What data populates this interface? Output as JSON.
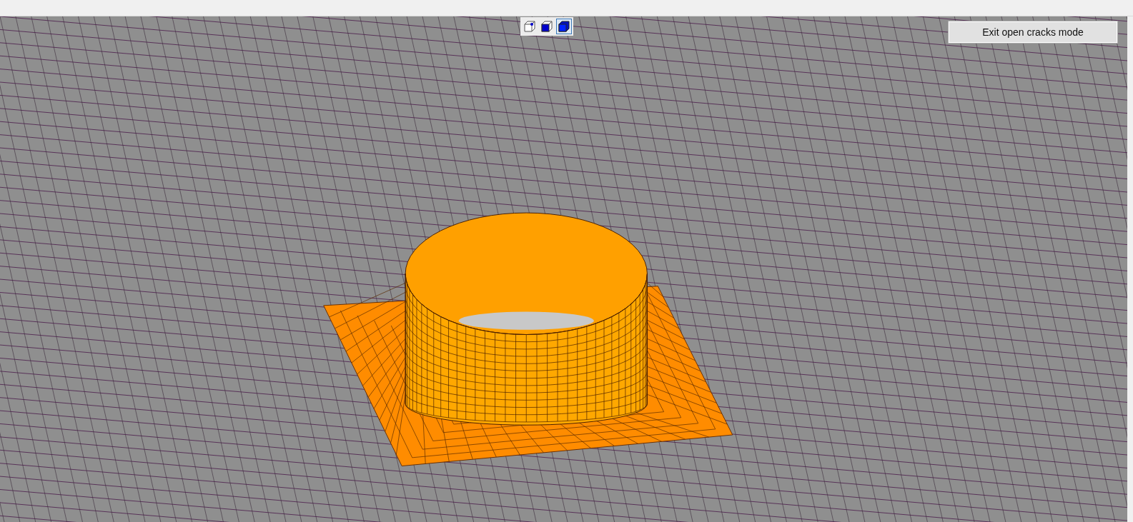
{
  "view_modes": [
    {
      "kind": "points",
      "selected": false
    },
    {
      "kind": "faces",
      "selected": false
    },
    {
      "kind": "solid",
      "selected": true
    }
  ],
  "exit_button": {
    "label": "Exit open cracks mode"
  }
}
